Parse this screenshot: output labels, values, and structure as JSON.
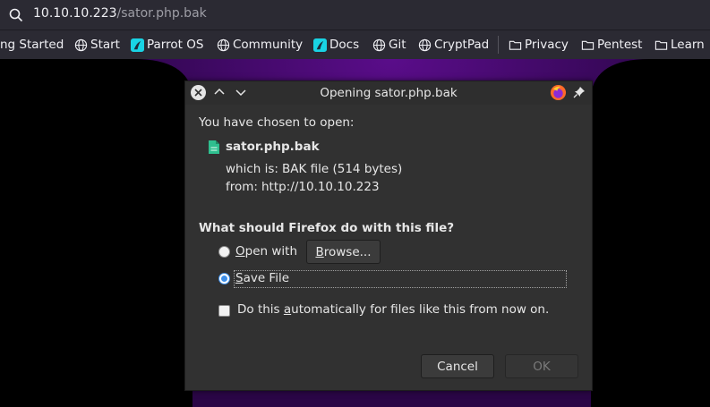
{
  "urlbar": {
    "host": "10.10.10.223",
    "path": "/sator.php.bak"
  },
  "bookmarks": [
    {
      "label": "ng Started",
      "icon": "globe-icon"
    },
    {
      "label": "Start",
      "icon": "globe-icon"
    },
    {
      "label": "Parrot OS",
      "icon": "parrot-icon"
    },
    {
      "label": "Community",
      "icon": "globe-icon"
    },
    {
      "label": "Docs",
      "icon": "parrot-icon"
    },
    {
      "label": "Git",
      "icon": "globe-icon"
    },
    {
      "label": "CryptPad",
      "icon": "globe-icon"
    },
    {
      "label": "Privacy",
      "icon": "folder-icon"
    },
    {
      "label": "Pentest",
      "icon": "folder-icon"
    },
    {
      "label": "Learn",
      "icon": "folder-icon"
    }
  ],
  "dialog": {
    "title": "Opening sator.php.bak",
    "intro": "You have chosen to open:",
    "filename": "sator.php.bak",
    "which_is_label": "which is:",
    "which_is_value": "BAK file (514 bytes)",
    "from_label": "from:",
    "from_value": "http://10.10.10.223",
    "question": "What should Firefox do with this file?",
    "open_with": {
      "pre": "",
      "accel": "O",
      "post": "pen with"
    },
    "browse": {
      "accel": "B",
      "post": "rowse..."
    },
    "save_file": {
      "accel": "S",
      "post": "ave File"
    },
    "auto": {
      "pre": "Do this ",
      "accel": "a",
      "post": "utomatically for files like this from now on."
    },
    "cancel_label": "Cancel",
    "ok_label": "OK",
    "selected_option": "save-file"
  },
  "colors": {
    "accent": "#3d8ee8",
    "background_glow": "#4a0a73",
    "file_icon": "#2fbf8f"
  }
}
